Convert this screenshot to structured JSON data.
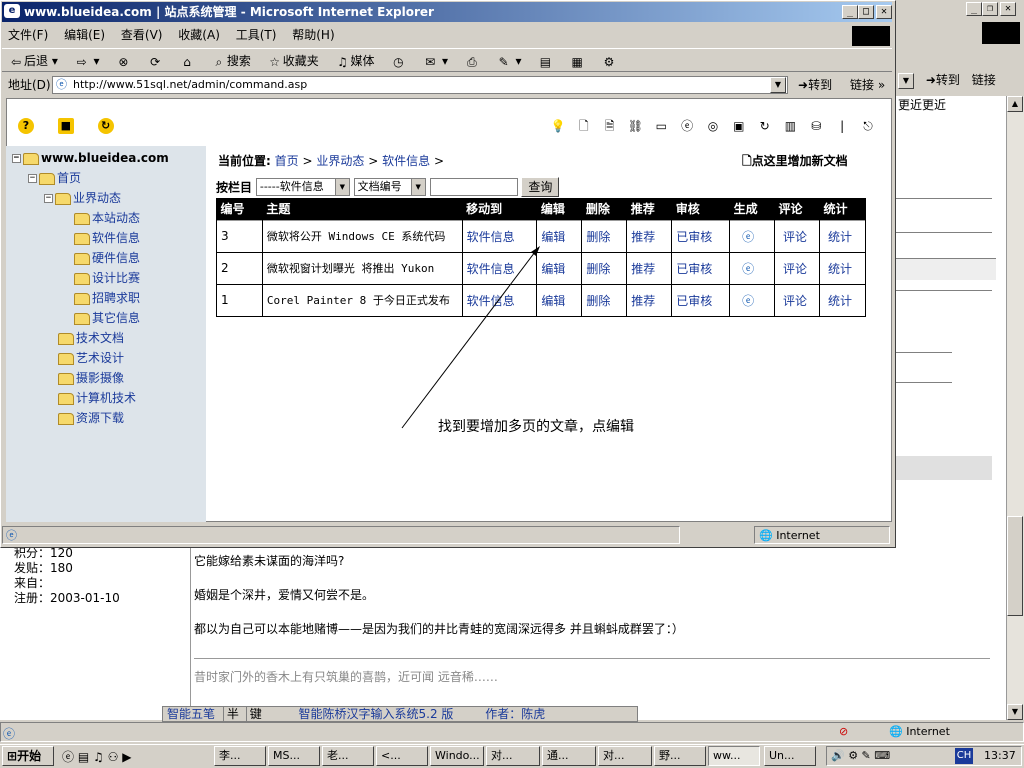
{
  "window_title": "www.blueidea.com   | 站点系统管理 - Microsoft Internet Explorer",
  "menu": [
    "文件(F)",
    "编辑(E)",
    "查看(V)",
    "收藏(A)",
    "工具(T)",
    "帮助(H)"
  ],
  "toolbar": {
    "back": "后退",
    "search": "搜索",
    "favorites": "收藏夹",
    "media": "媒体"
  },
  "address": {
    "label": "地址(D)",
    "url": "http://www.51sql.net/admin/command.asp",
    "go": "转到",
    "links": "链接"
  },
  "bg_address": {
    "go": "转到",
    "links": "链接"
  },
  "bg_snippet": "更近更近",
  "status": {
    "zone": "Internet"
  },
  "tree": {
    "root": "www.blueidea.com",
    "home": "首页",
    "industry": "业界动态",
    "children": [
      "本站动态",
      "软件信息",
      "硬件信息",
      "设计比赛",
      "招聘求职",
      "其它信息"
    ],
    "others": [
      "技术文档",
      "艺术设计",
      "摄影摄像",
      "计算机技术",
      "资源下载"
    ]
  },
  "location": {
    "label": "当前位置:",
    "crumbs": [
      "首页",
      "业界动态",
      "软件信息"
    ],
    "sep": ">"
  },
  "add_doc": "点这里增加新文档",
  "filter": {
    "label": "按栏目",
    "category": "-----软件信息",
    "field": "文档编号",
    "search_button": "查询"
  },
  "table": {
    "headers": [
      "编号",
      "主题",
      "移动到",
      "编辑",
      "删除",
      "推荐",
      "审核",
      "生成",
      "评论",
      "统计"
    ],
    "rows": [
      {
        "id": "3",
        "title": "微软将公开 Windows CE 系统代码",
        "move": "软件信息",
        "edit": "编辑",
        "delete": "删除",
        "recommend": "推荐",
        "audit": "已审核",
        "comment": "评论",
        "stats": "统计"
      },
      {
        "id": "2",
        "title": "微软视窗计划曝光 将推出 Yukon",
        "move": "软件信息",
        "edit": "编辑",
        "delete": "删除",
        "recommend": "推荐",
        "audit": "已审核",
        "comment": "评论",
        "stats": "统计"
      },
      {
        "id": "1",
        "title": "Corel Painter 8 于今日正式发布",
        "move": "软件信息",
        "edit": "编辑",
        "delete": "删除",
        "recommend": "推荐",
        "audit": "已审核",
        "comment": "评论",
        "stats": "统计"
      }
    ]
  },
  "annotation": "找到要增加多页的文章，点编辑",
  "bg_post": {
    "user_lines": [
      "积分：120",
      "发贴：180",
      "来自：",
      "注册：2003-01-10"
    ],
    "lines": [
      "它能嫁给素未谋面的海洋吗?",
      "婚姻是个深井，爱情又何尝不是。",
      "都以为自己可以本能地赌博——是因为我们的井比青蛙的宽阔深远得多 并且蝌蚪成群罢了：）",
      "昔时家门外的香木上有只筑巢的喜鹊，近可闻 远音稀……"
    ]
  },
  "ime": {
    "mode": "智能五笔",
    "half": "半",
    "key": "键",
    "name": "智能陈桥汉字输入系统5.2 版",
    "author": "作者：陈虎",
    "color": "蓝色"
  },
  "taskbar": {
    "start": "开始",
    "tasks": [
      "李...",
      "MS...",
      "老...",
      "<...",
      "Windo...",
      "对...",
      "通...",
      "对...",
      "野...",
      "ww...",
      "Un..."
    ],
    "lang": "CH",
    "clock": "13:37"
  }
}
